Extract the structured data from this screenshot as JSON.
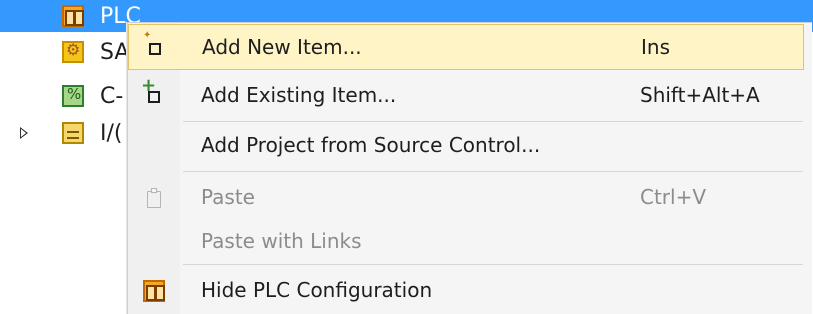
{
  "tree": {
    "items": [
      {
        "label": "PLC",
        "icon": "plc-icon",
        "selected": true
      },
      {
        "label": "SA",
        "icon": "safety-icon"
      },
      {
        "label": "C-",
        "icon": "c-plus-plus-icon"
      },
      {
        "label": "I/(",
        "icon": "io-icon",
        "expandable": true
      }
    ]
  },
  "context_menu": {
    "items": [
      {
        "label": "Add New Item...",
        "shortcut": "Ins",
        "icon": "add-new-item-icon",
        "state": "highlighted"
      },
      {
        "label": "Add Existing Item...",
        "shortcut": "Shift+Alt+A",
        "icon": "add-existing-item-icon"
      },
      {
        "label": "Add Project from Source Control...",
        "shortcut": ""
      },
      {
        "label": "Paste",
        "shortcut": "Ctrl+V",
        "icon": "paste-icon",
        "state": "disabled"
      },
      {
        "label": "Paste with Links",
        "shortcut": "",
        "state": "disabled"
      },
      {
        "label": "Hide PLC Configuration",
        "shortcut": "",
        "icon": "plc-icon"
      }
    ]
  },
  "colors": {
    "selection": "#3399ff",
    "menu_highlight": "#fef4c5",
    "menu_highlight_border": "#e5c365",
    "disabled_text": "#8c8c8c"
  }
}
